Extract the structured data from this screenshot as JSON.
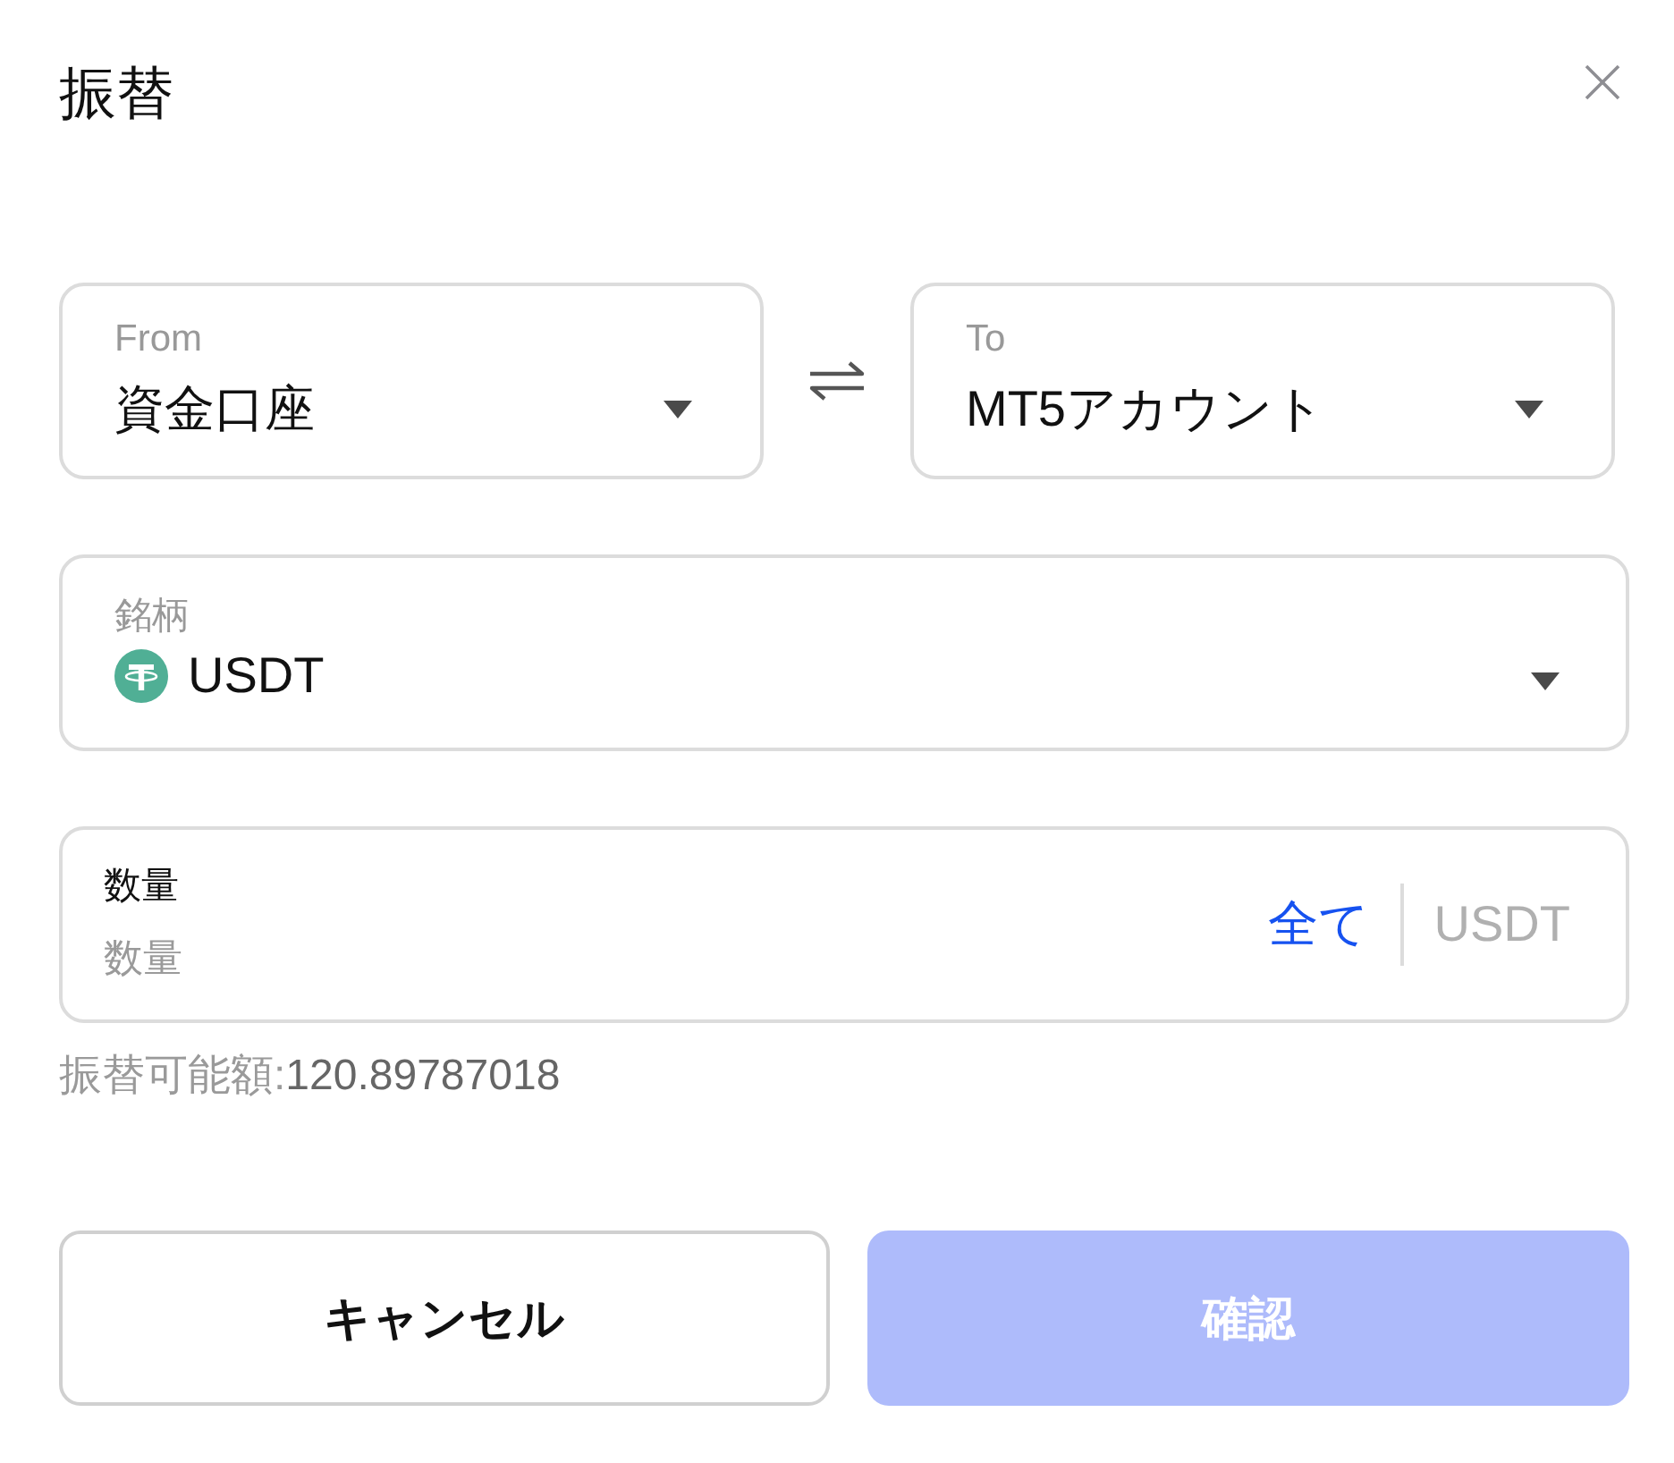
{
  "dialog": {
    "title": "振替"
  },
  "transfer": {
    "from": {
      "label": "From",
      "value": "資金口座"
    },
    "to": {
      "label": "To",
      "value": "MT5アカウント"
    }
  },
  "asset": {
    "label": "銘柄",
    "value": "USDT"
  },
  "amount": {
    "label": "数量",
    "placeholder": "数量",
    "max_link": "全て",
    "unit": "USDT"
  },
  "available": {
    "label": "振替可能額:",
    "value": "120.89787018"
  },
  "buttons": [
    {
      "label": "キャンセル",
      "kind": "secondary",
      "disabled": false
    },
    {
      "label": "確認",
      "kind": "primary",
      "disabled": true
    }
  ]
}
